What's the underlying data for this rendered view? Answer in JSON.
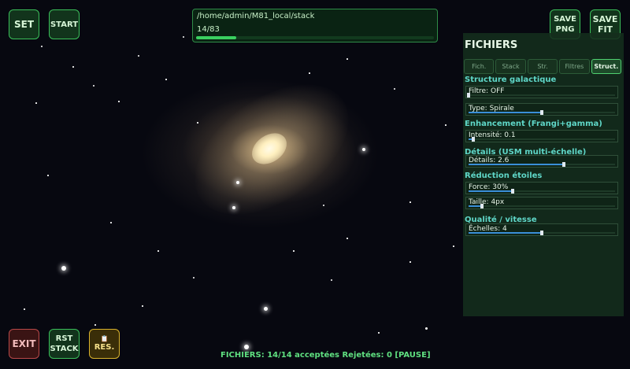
{
  "toolbar": {
    "set_label": "SET",
    "start_label": "START",
    "save_png_label": [
      "SAVE",
      "PNG"
    ],
    "save_fit_label": [
      "SAVE",
      "FIT"
    ]
  },
  "bottom": {
    "exit_label": "EXIT",
    "rst_stack_label": [
      "RST",
      "STACK"
    ],
    "res_icon": "clipboard-icon",
    "res_icon_glyph": "📋",
    "res_label": "RES."
  },
  "path_box": {
    "path": "/home/admin/M81_local/stack",
    "count": "14/83",
    "progress": 0.169
  },
  "panel": {
    "title": "FICHIERS",
    "tabs": [
      {
        "label": "Fich.",
        "active": false
      },
      {
        "label": "Stack",
        "active": false
      },
      {
        "label": "Str.",
        "active": false
      },
      {
        "label": "Filtres",
        "active": false
      },
      {
        "label": "Struct.",
        "active": true
      }
    ],
    "sections": [
      {
        "title": "Structure galactique",
        "sliders": [
          {
            "label": "Filtre: OFF",
            "value": 0.0
          },
          {
            "label": "Type: Spirale",
            "value": 0.5
          }
        ]
      },
      {
        "title": "Enhancement (Frangi+gamma)",
        "sliders": [
          {
            "label": "Intensité: 0.1",
            "value": 0.03
          }
        ]
      },
      {
        "title": "Détails (USM multi-échelle)",
        "sliders": [
          {
            "label": "Détails: 2.6",
            "value": 0.65
          }
        ]
      },
      {
        "title": "Réduction étoiles",
        "sliders": [
          {
            "label": "Force: 30%",
            "value": 0.3
          },
          {
            "label": "Taille: 4px",
            "value": 0.09
          }
        ]
      },
      {
        "title": "Qualité / vitesse",
        "sliders": [
          {
            "label": "Échelles: 4",
            "value": 0.5
          }
        ]
      }
    ]
  },
  "status": "FICHIERS: 14/14 acceptées  Rejetées: 0  [PAUSE]",
  "colors": {
    "accent_green": "#3bbf5a",
    "section_cyan": "#5fd7c8",
    "slider_blue": "#3a8fd8",
    "exit_red": "#b84848",
    "res_amber": "#d8b22c"
  }
}
